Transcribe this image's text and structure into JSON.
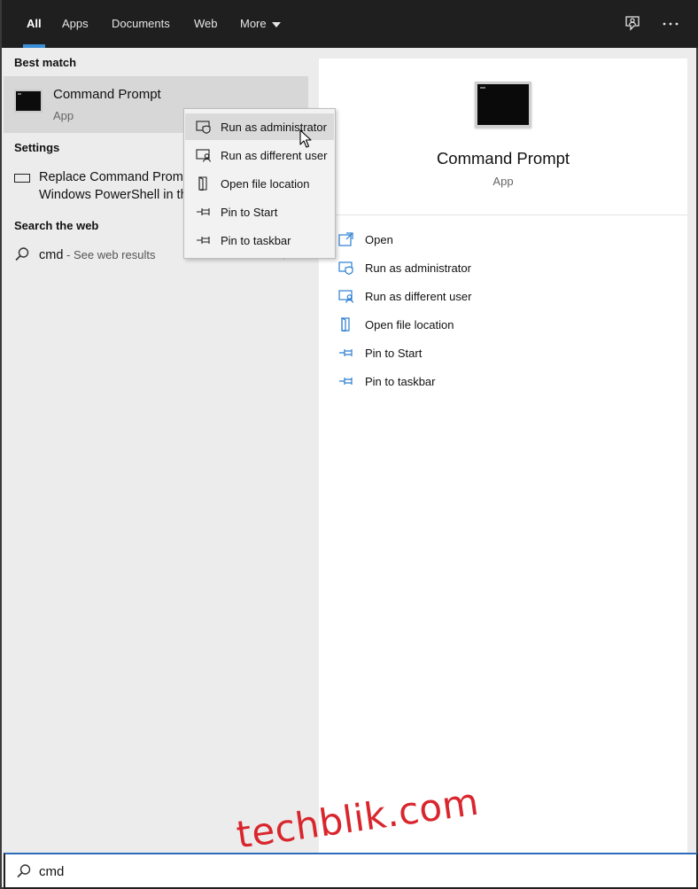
{
  "tabs": [
    {
      "label": "All",
      "active": true
    },
    {
      "label": "Apps",
      "active": false
    },
    {
      "label": "Documents",
      "active": false
    },
    {
      "label": "Web",
      "active": false
    },
    {
      "label": "More",
      "active": false
    }
  ],
  "topbar_icons": [
    "feedback-icon",
    "more-options-icon"
  ],
  "left": {
    "best_match_header": "Best match",
    "best_match": {
      "title": "Command Prompt",
      "subtitle": "App",
      "icon": "command-prompt-icon"
    },
    "settings_header": "Settings",
    "settings_item": {
      "line1": "Replace Command Prompt with",
      "line2": "Windows PowerShell in the",
      "icon": "monitor-icon"
    },
    "web_header": "Search the web",
    "web_item": {
      "query": "cmd",
      "suffix": " - See web results",
      "icon": "search-icon"
    }
  },
  "context_menu": [
    {
      "label": "Run as administrator",
      "icon": "shield-icon",
      "highlighted": true
    },
    {
      "label": "Run as different user",
      "icon": "user-icon",
      "highlighted": false
    },
    {
      "label": "Open file location",
      "icon": "file-location-icon",
      "highlighted": false
    },
    {
      "label": "Pin to Start",
      "icon": "pin-icon",
      "highlighted": false
    },
    {
      "label": "Pin to taskbar",
      "icon": "pin-icon",
      "highlighted": false
    }
  ],
  "right": {
    "title": "Command Prompt",
    "subtitle": "App",
    "actions": [
      {
        "label": "Open",
        "icon": "open-icon"
      },
      {
        "label": "Run as administrator",
        "icon": "shield-icon"
      },
      {
        "label": "Run as different user",
        "icon": "user-icon"
      },
      {
        "label": "Open file location",
        "icon": "file-location-icon"
      },
      {
        "label": "Pin to Start",
        "icon": "pin-icon"
      },
      {
        "label": "Pin to taskbar",
        "icon": "pin-icon"
      }
    ]
  },
  "search": {
    "value": "cmd"
  },
  "watermark": "techblik.com",
  "colors": {
    "accent": "#3a8fd8",
    "topbar": "#1f1f1f",
    "action_icon": "#2a7ed0",
    "watermark": "#d9262d"
  }
}
